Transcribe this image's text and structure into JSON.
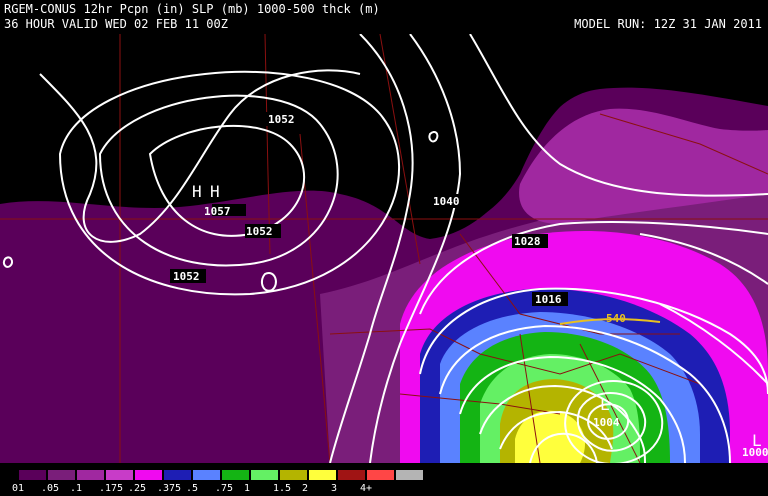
{
  "header": {
    "line1": "RGEM-CONUS 12hr Pcpn (in) SLP (mb) 1000-500 thck (m)",
    "line2": "36 HOUR VALID WED 02 FEB 11 00Z",
    "model_run": "MODEL RUN: 12Z 31 JAN 2011"
  },
  "map": {
    "isobar_labels": [
      "1052",
      "1057",
      "1052",
      "1052",
      "1040",
      "1028",
      "1016",
      "1004",
      "1000"
    ],
    "thickness_label": "540",
    "pressure_centers": [
      "H",
      "H",
      "L",
      "L"
    ]
  },
  "legend": {
    "bins": [
      {
        "label": "01",
        "color": "#5a005a"
      },
      {
        "label": ".05",
        "color": "#7a1e7a"
      },
      {
        "label": ".1",
        "color": "#a028a0"
      },
      {
        "label": ".175",
        "color": "#c83cc8"
      },
      {
        "label": ".25",
        "color": "#f00af0"
      },
      {
        "label": ".375",
        "color": "#1e1eb4"
      },
      {
        "label": ".5",
        "color": "#5a82ff"
      },
      {
        "label": ".75",
        "color": "#14b414"
      },
      {
        "label": "1",
        "color": "#64f064"
      },
      {
        "label": "1.5",
        "color": "#b4b400"
      },
      {
        "label": "2",
        "color": "#ffff3c"
      },
      {
        "label": "3",
        "color": "#a01414"
      },
      {
        "label": "4+",
        "color": "#ff4646"
      },
      {
        "label": "",
        "color": "#b4b4b4"
      }
    ]
  }
}
